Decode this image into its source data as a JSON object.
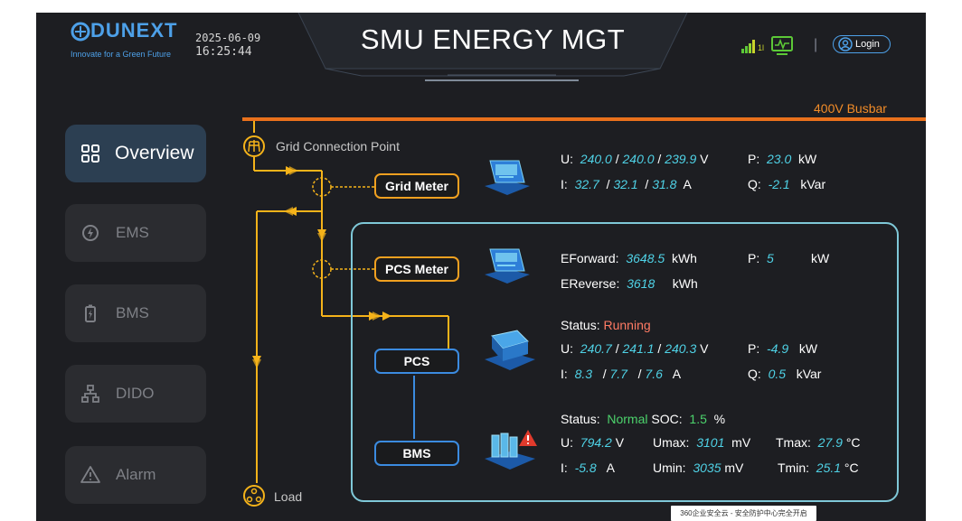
{
  "header": {
    "brand": "DUNEXT",
    "slogan": "Innovate for a Green Future",
    "date": "2025-06-09",
    "time": "16:25:44",
    "title": "SMU ENERGY MGT",
    "login_label": "Login",
    "divider": "|",
    "signal_suffix": "1l"
  },
  "busbar": {
    "label": "400V Busbar"
  },
  "sidebar": {
    "items": [
      {
        "label": "Overview",
        "icon": "grid-icon",
        "active": true
      },
      {
        "label": "EMS",
        "icon": "power-icon",
        "active": false
      },
      {
        "label": "BMS",
        "icon": "battery-icon",
        "active": false
      },
      {
        "label": "DIDO",
        "icon": "network-icon",
        "active": false
      },
      {
        "label": "Alarm",
        "icon": "warning-icon",
        "active": false
      }
    ]
  },
  "topology": {
    "grid_point_label": "Grid Connection Point",
    "grid_meter_label": "Grid Meter",
    "pcs_meter_label": "PCS Meter",
    "pcs_label": "PCS",
    "bms_label": "BMS",
    "load_label": "Load"
  },
  "grid_meter": {
    "u_label": "U:",
    "u1": "240.0",
    "u2": "240.0",
    "u3": "239.9",
    "u_unit": "V",
    "p_label": "P:",
    "p": "23.0",
    "p_unit": "kW",
    "i_label": "I:",
    "i1": "32.7",
    "i2": "32.1",
    "i3": "31.8",
    "i_unit": "A",
    "q_label": "Q:",
    "q": "-2.1",
    "q_unit": "kVar"
  },
  "pcs_meter": {
    "ef_label": "EForward:",
    "ef": "3648.5",
    "ef_unit": "kWh",
    "p_label": "P:",
    "p": "5",
    "p_unit": "kW",
    "er_label": "EReverse:",
    "er": "3618",
    "er_unit": "kWh"
  },
  "pcs": {
    "status_label": "Status:",
    "status": "Running",
    "u_label": "U:",
    "u1": "240.7",
    "u2": "241.1",
    "u3": "240.3",
    "u_unit": "V",
    "p_label": "P:",
    "p": "-4.9",
    "p_unit": "kW",
    "i_label": "I:",
    "i1": "8.3",
    "i2": "7.7",
    "i3": "7.6",
    "i_unit": "A",
    "q_label": "Q:",
    "q": "0.5",
    "q_unit": "kVar"
  },
  "bms": {
    "status_label": "Status:",
    "status": "Normal",
    "soc_label": "SOC:",
    "soc": "1.5",
    "soc_unit": "%",
    "u_label": "U:",
    "u": "794.2",
    "u_unit": "V",
    "umax_label": "Umax:",
    "umax": "3101",
    "umax_unit": "mV",
    "tmax_label": "Tmax:",
    "tmax": "27.9",
    "tmax_unit": "°C",
    "i_label": "I:",
    "i": "-5.8",
    "i_unit": "A",
    "umin_label": "Umin:",
    "umin": "3035",
    "umin_unit": "mV",
    "tmin_label": "Tmin:",
    "tmin": "25.1",
    "tmin_unit": "°C"
  },
  "watermark": {
    "text": "360企业安全云 - 安全防护中心完全开启"
  },
  "colors": {
    "accent": "#4da0e8",
    "busbar": "#e9711c",
    "flow": "#f5b31a",
    "value": "#4fd2e6",
    "ok": "#4cd36c",
    "running": "#ff7b64"
  }
}
